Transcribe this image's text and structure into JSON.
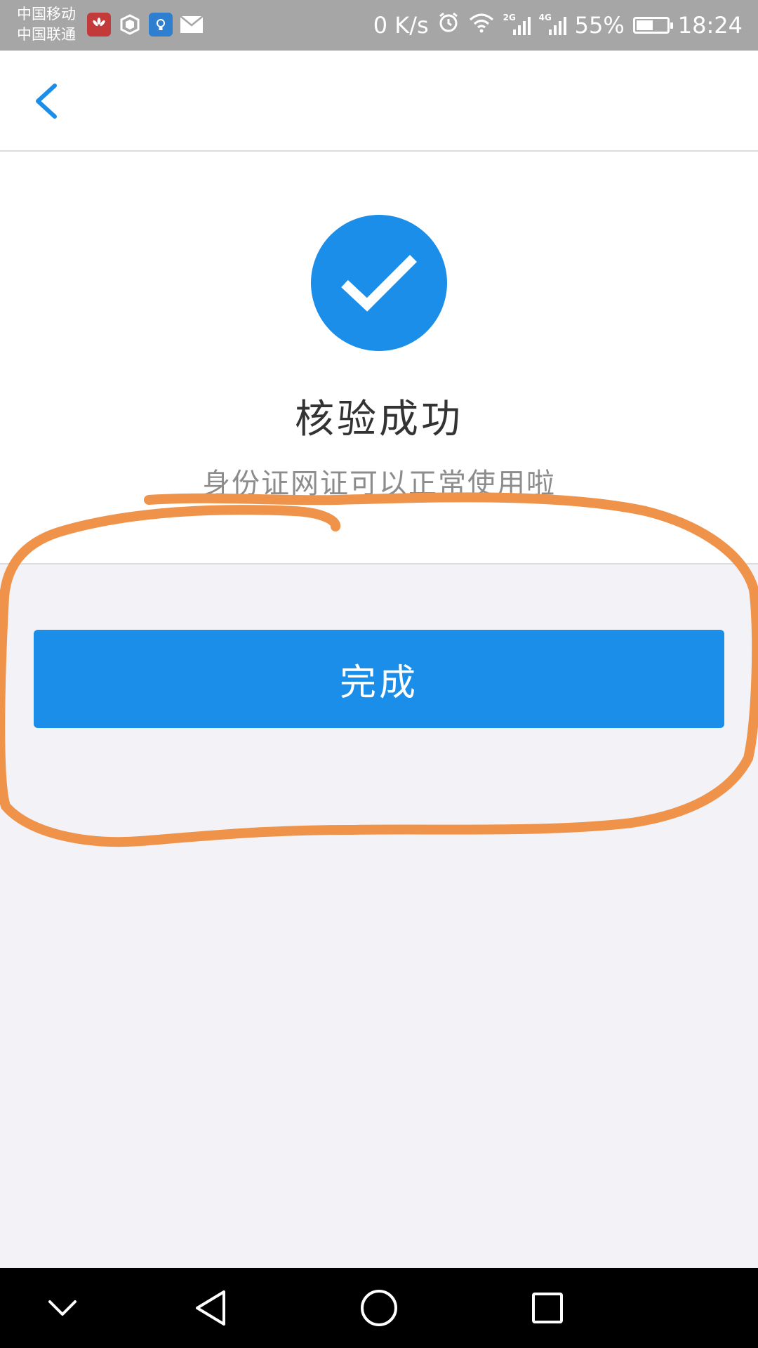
{
  "status_bar": {
    "carrier_1": "中国移动",
    "carrier_2": "中国联通",
    "net_speed": "0 K/s",
    "net_2g": "2G",
    "net_4g": "4G",
    "battery": "55%",
    "battery_level": 0.55,
    "time": "18:24",
    "icons": [
      "huawei-app-icon",
      "shield-app-icon",
      "lightbulb-app-icon",
      "mail-icon",
      "alarm-icon",
      "wifi-icon",
      "signal-2g-icon",
      "signal-4g-icon",
      "battery-icon"
    ]
  },
  "header": {
    "back_icon": "chevron-left-icon"
  },
  "success": {
    "icon": "check-circle-icon",
    "title": "核验成功",
    "subtitle": "身份证网证可以正常使用啦"
  },
  "actions": {
    "done_label": "完成"
  },
  "nav_bar": {
    "buttons": [
      "chevron-down-icon",
      "back-triangle-icon",
      "home-circle-icon",
      "recents-square-icon"
    ]
  },
  "colors": {
    "accent": "#1a8ee8",
    "annotation": "#f0934a",
    "status_bar": "#a6a6a6"
  }
}
